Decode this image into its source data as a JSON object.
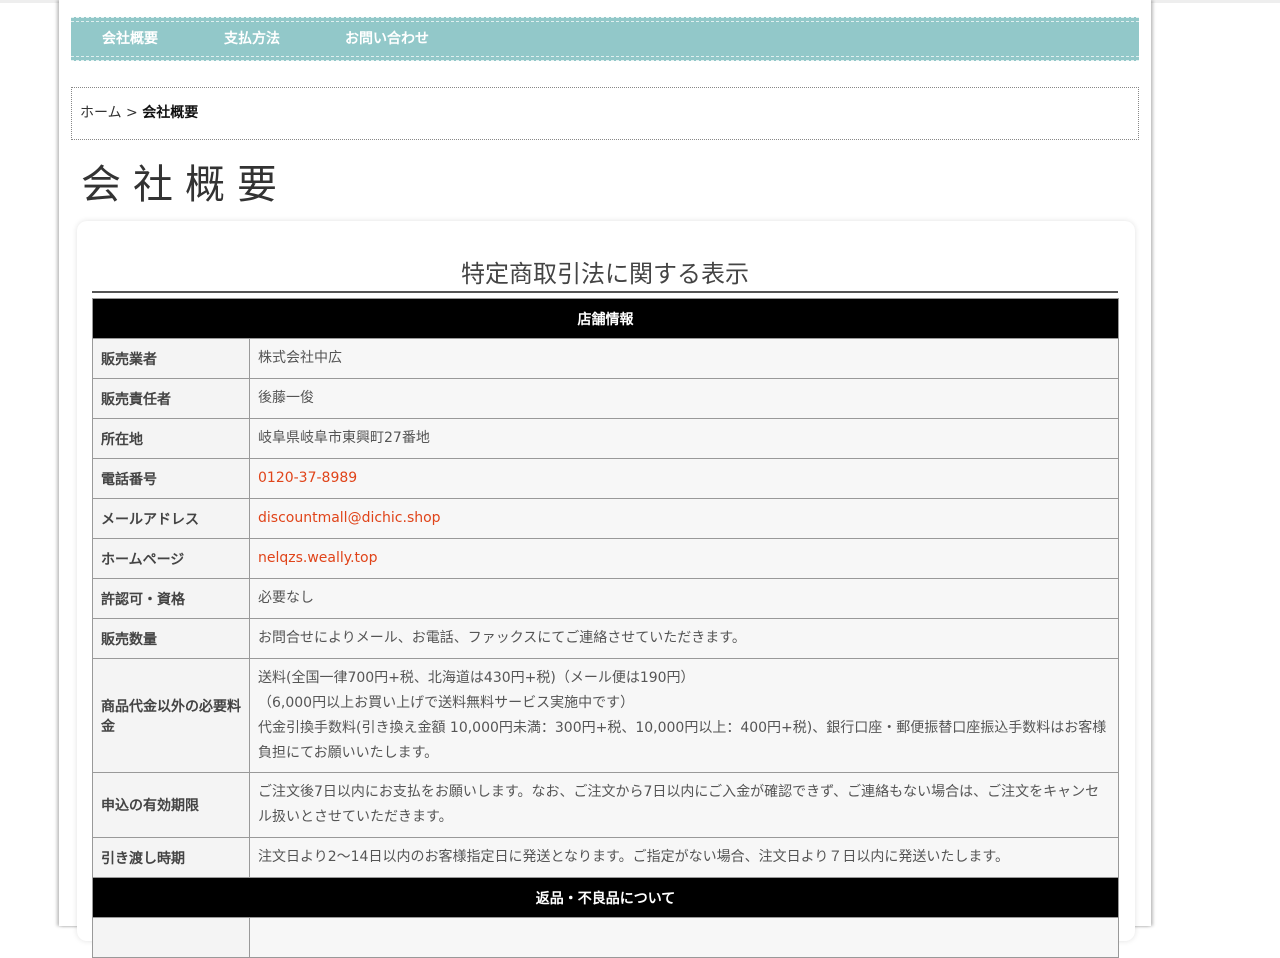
{
  "nav": {
    "items": [
      "会社概要",
      "支払方法",
      "お問い合わせ"
    ]
  },
  "breadcrumb": {
    "home": "ホーム",
    "separator": ">",
    "current": "会社概要"
  },
  "page_title": "会社概要",
  "section_title": "特定商取引法に関する表示",
  "table": {
    "header_store": "店舗情報",
    "rows": [
      {
        "label": "販売業者",
        "value": "株式会社中広"
      },
      {
        "label": "販売責任者",
        "value": "後藤一俊"
      },
      {
        "label": "所在地",
        "value": "岐阜県岐阜市東興町27番地"
      },
      {
        "label": "電話番号",
        "value": "0120-37-8989"
      },
      {
        "label": "メールアドレス",
        "value": "discountmall@dichic.shop"
      },
      {
        "label": "ホームページ",
        "value": "nelqzs.weally.top"
      },
      {
        "label": "許認可・資格",
        "value": "必要なし"
      },
      {
        "label": "販売数量",
        "value": "お問合せによりメール、お電話、ファックスにてご連絡させていただきます。"
      }
    ],
    "fee": {
      "label": "商品代金以外の必要料金",
      "lines": [
        "送料(全国一律700円+税、北海道は430円+税)（メール便は190円）",
        "（6,000円以上お買い上げで送料無料サービス実施中です）",
        "代金引換手数料(引き換え金額 10,000円未満：300円+税、10,000円以上：400円+税)、銀行口座・郵便振替口座振込手数料はお客様負担にてお願いいたします。"
      ]
    },
    "validity": {
      "label": "申込の有効期限",
      "value": "ご注文後7日以内にお支払をお願いします。なお、ご注文から7日以内にご入金が確認できず、ご連絡もない場合は、ご注文をキャンセル扱いとさせていただきます。"
    },
    "delivery": {
      "label": "引き渡し時期",
      "value": "注文日より2〜14日以内のお客様指定日に発送となります。ご指定がない場合、注文日より７日以内に発送いたします。"
    },
    "header_returns": "返品・不良品について"
  },
  "colors": {
    "nav_bg": "#92c8c9",
    "link": "#e0441a",
    "table_header_bg": "#000000"
  }
}
